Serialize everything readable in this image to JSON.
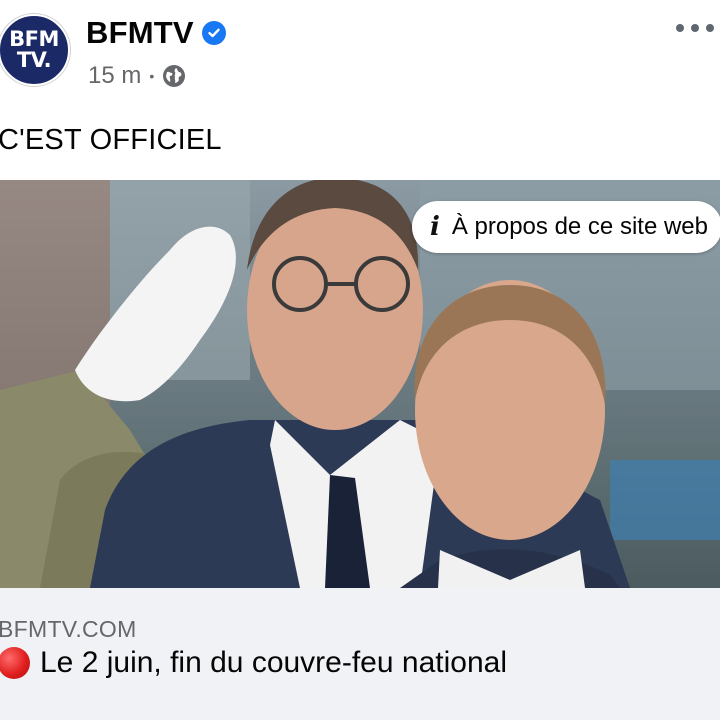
{
  "post": {
    "author": "BFMTV",
    "avatar_text": [
      "BFM",
      "TV."
    ],
    "time": "15 m",
    "separator": "•",
    "privacy_icon": "globe-icon",
    "verified_icon": "verified-badge-icon",
    "more_icon": "more-options-icon",
    "text": "C'EST OFFICIEL"
  },
  "image": {
    "info_button_label": "À propos de ce site web",
    "info_icon": "info-icon",
    "info_glyph": "i"
  },
  "link_preview": {
    "domain": "BFMTV.COM",
    "headline": "Le 2 juin, fin du couvre-feu national",
    "headline_icon": "red-circle-icon"
  },
  "colors": {
    "verified": "#1877f2",
    "avatar_bg": "#1b2a66",
    "link_card_bg": "#f0f2f5",
    "secondary_text": "#65676b"
  }
}
